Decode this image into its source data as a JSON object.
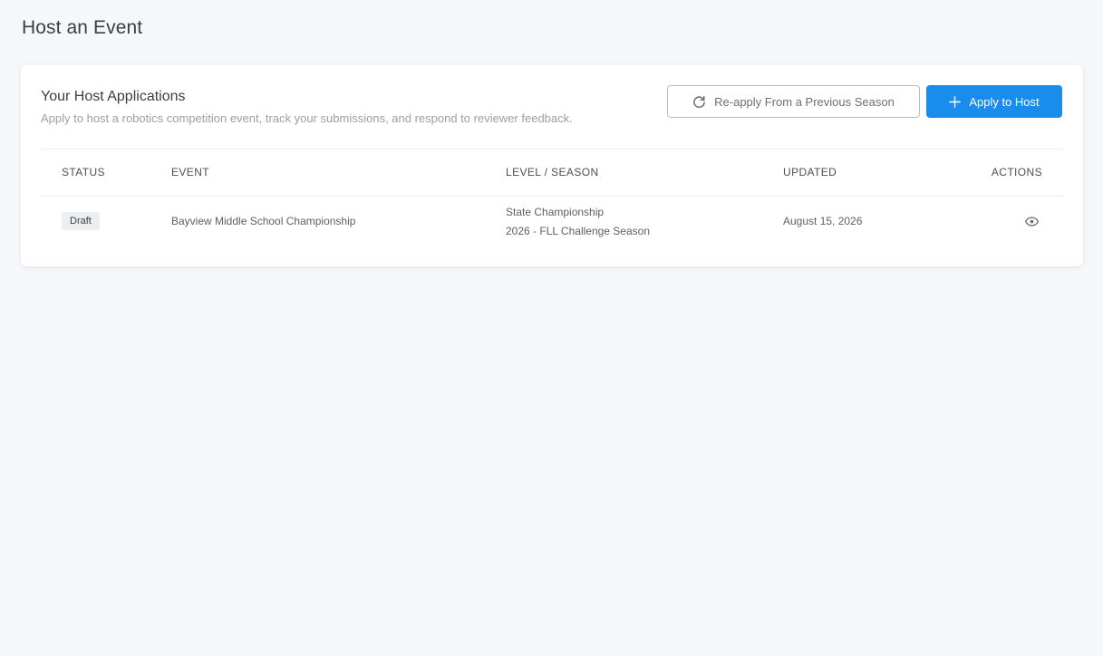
{
  "page": {
    "title": "Host an Event"
  },
  "card": {
    "title": "Your Host Applications",
    "subtitle": "Apply to host a robotics competition event, track your submissions, and respond to reviewer feedback.",
    "reapply_button": {
      "label": "Re-apply From a Previous Season",
      "icon": "refresh-icon"
    },
    "apply_button": {
      "label": "Apply to Host",
      "icon": "plus-icon"
    }
  },
  "table": {
    "headers": {
      "status": "STATUS",
      "event": "EVENT",
      "level": "LEVEL / SEASON",
      "updated": "UPDATED",
      "actions": "ACTIONS"
    },
    "rows": [
      {
        "status": "Draft",
        "event": "Bayview Middle School Championship",
        "level": "State Championship",
        "season": "2026 - FLL Challenge Season",
        "updated": "August 15, 2026",
        "action_icon": "eye-icon"
      }
    ]
  },
  "colors": {
    "primary": "#1a8cec",
    "background": "#f6f7fa",
    "badge_bg": "#eceef0"
  }
}
